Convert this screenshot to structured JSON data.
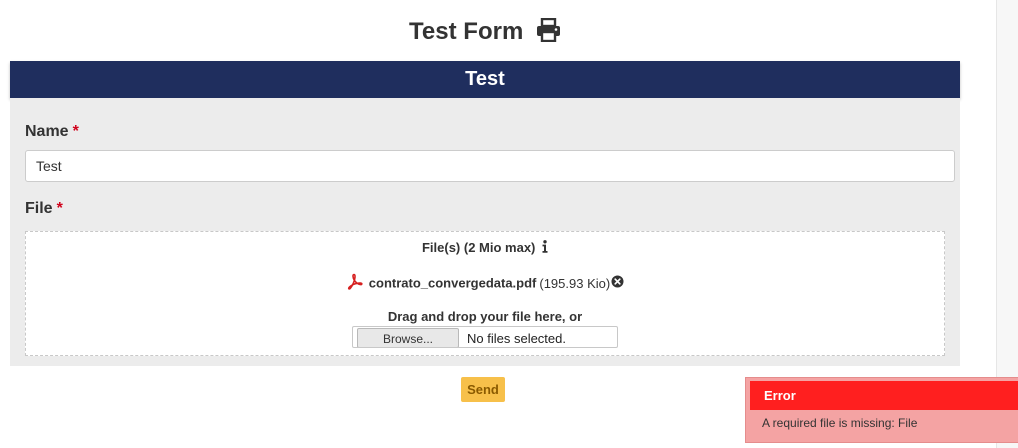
{
  "page": {
    "title": "Test Form",
    "print_icon": "print-icon"
  },
  "form": {
    "banner_title": "Test",
    "required_marker": "*",
    "name_field": {
      "label": "Name",
      "value": "Test"
    },
    "file_field": {
      "label": "File",
      "dropzone_title": "File(s) (2 Mio max)",
      "info_icon": "info-icon",
      "uploaded_file": {
        "icon": "pdf-icon",
        "name": "contrato_convergedata.pdf",
        "size": "(195.93 Kio)",
        "remove_icon": "remove-circle-icon"
      },
      "drag_text": "Drag and drop your file here, or",
      "browse_label": "Browse...",
      "no_file_text": "No files selected."
    },
    "send_label": "Send"
  },
  "toast": {
    "title": "Error",
    "message": "A required file is missing: File"
  },
  "colors": {
    "banner_bg": "#1f2e5e",
    "send_button": "#f7c04a",
    "toast_header": "#ff1f1f",
    "toast_body": "#f4a3a3",
    "required": "#d0021b"
  }
}
